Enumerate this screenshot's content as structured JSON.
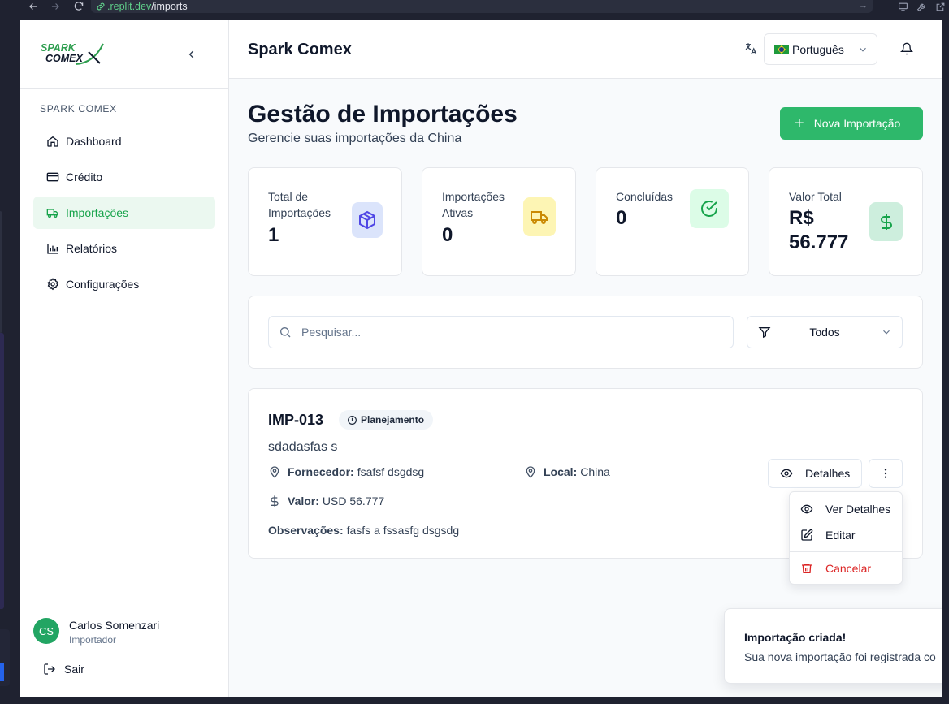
{
  "browser": {
    "url_host": ".replit.dev",
    "url_path": "/imports"
  },
  "sidebar": {
    "logo_line1": "SPARK",
    "logo_line2": "COMEX",
    "section_label": "SPARK COMEX",
    "items": [
      {
        "label": "Dashboard",
        "icon": "home-icon",
        "active": false
      },
      {
        "label": "Crédito",
        "icon": "credit-card-icon",
        "active": false
      },
      {
        "label": "Importações",
        "icon": "truck-icon",
        "active": true
      },
      {
        "label": "Relatórios",
        "icon": "bar-chart-icon",
        "active": false
      },
      {
        "label": "Configurações",
        "icon": "gear-icon",
        "active": false
      }
    ],
    "user": {
      "initials": "CS",
      "name": "Carlos Somenzari",
      "role": "Importador"
    },
    "logout_label": "Sair"
  },
  "header": {
    "title": "Spark Comex",
    "language": "Português"
  },
  "page": {
    "title": "Gestão de Importações",
    "subtitle": "Gerencie suas importações da China",
    "new_button": "Nova Importação"
  },
  "stats": [
    {
      "label": "Total de Importações",
      "value": "1",
      "icon": "package-icon",
      "color": "#4f46e5"
    },
    {
      "label": "Importações Ativas",
      "value": "0",
      "icon": "truck-icon",
      "color": "#ca8a04"
    },
    {
      "label": "Concluídas",
      "value": "0",
      "icon": "check-circle-icon",
      "color": "#16a34a"
    },
    {
      "label": "Valor Total",
      "value": "R$ 56.777",
      "icon": "dollar-icon",
      "color": "#16a34a"
    }
  ],
  "filters": {
    "search_placeholder": "Pesquisar...",
    "status_value": "Todos"
  },
  "import_item": {
    "code": "IMP-013",
    "status": "Planejamento",
    "description": "sdadasfas s",
    "supplier_label": "Fornecedor:",
    "supplier": "fsafsf dsgdsg",
    "location_label": "Local:",
    "location": "China",
    "value_label": "Valor:",
    "value": "USD 56.777",
    "notes_label": "Observações:",
    "notes": "fasfs a fssasfg dsgsdg",
    "details_button": "Detalhes"
  },
  "menu": {
    "view": "Ver Detalhes",
    "edit": "Editar",
    "cancel": "Cancelar"
  },
  "toast": {
    "title": "Importação criada!",
    "message": "Sua nova importação foi registrada co"
  },
  "colors": {
    "primary": "#2eb86b",
    "danger": "#dc2626"
  }
}
